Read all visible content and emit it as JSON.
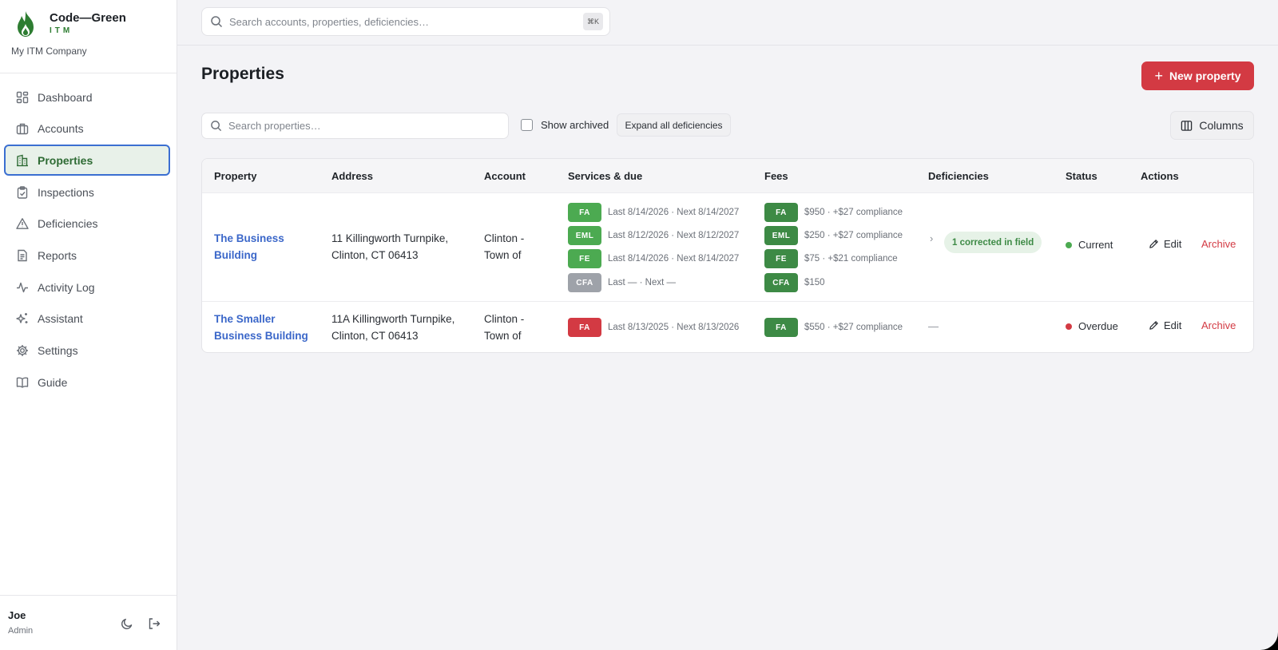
{
  "brand": {
    "name": "Code—Green",
    "sub": "ITM",
    "company": "My ITM Company"
  },
  "nav": [
    {
      "label": "Dashboard",
      "icon": "dashboard-icon"
    },
    {
      "label": "Accounts",
      "icon": "briefcase-icon"
    },
    {
      "label": "Properties",
      "icon": "building-icon",
      "active": true
    },
    {
      "label": "Inspections",
      "icon": "clipboard-check-icon"
    },
    {
      "label": "Deficiencies",
      "icon": "warning-triangle-icon"
    },
    {
      "label": "Reports",
      "icon": "document-icon"
    },
    {
      "label": "Activity Log",
      "icon": "activity-icon"
    },
    {
      "label": "Assistant",
      "icon": "sparkles-icon"
    },
    {
      "label": "Settings",
      "icon": "gear-icon"
    },
    {
      "label": "Guide",
      "icon": "book-icon"
    }
  ],
  "user": {
    "name": "Joe",
    "role": "Admin"
  },
  "search": {
    "placeholder": "Search accounts, properties, deficiencies…",
    "shortcut": "⌘K"
  },
  "page": {
    "title": "Properties",
    "new_button": "New property",
    "search_placeholder": "Search properties…",
    "show_archived": "Show archived",
    "expand_all": "Expand all deficiencies",
    "columns_button": "Columns"
  },
  "table": {
    "headers": [
      "Property",
      "Address",
      "Account",
      "Services & due",
      "Fees",
      "Deficiencies",
      "Status",
      "Actions"
    ],
    "rows": [
      {
        "property": "The Business Building",
        "address_line1": "11 Killingworth Turnpike,",
        "address_line2": "Clinton, CT 06413",
        "account_line1": "Clinton -",
        "account_line2": "Town of",
        "services": [
          {
            "code": "FA",
            "text": "Last 8/14/2026 · Next 8/14/2027",
            "color": "#4caa51"
          },
          {
            "code": "EML",
            "text": "Last 8/12/2026 · Next 8/12/2027",
            "color": "#4caa51"
          },
          {
            "code": "FE",
            "text": "Last 8/14/2026 · Next 8/14/2027",
            "color": "#4caa51"
          },
          {
            "code": "CFA",
            "text": "Last — · Next —",
            "color": "#9ea2a9"
          }
        ],
        "fees": [
          {
            "code": "FA",
            "text": "$950 · +$27 compliance"
          },
          {
            "code": "EML",
            "text": "$250 · +$27 compliance"
          },
          {
            "code": "FE",
            "text": "$75 · +$21 compliance"
          },
          {
            "code": "CFA",
            "text": "$150"
          }
        ],
        "deficiency": "1 corrected in field",
        "status": "Current",
        "status_color": "#4caa51",
        "edit": "Edit",
        "archive": "Archive"
      },
      {
        "property_line1": "The Smaller",
        "property_line2": "Business Building",
        "address_line1": "11A Killingworth Turnpike,",
        "address_line2": "Clinton, CT 06413",
        "account_line1": "Clinton -",
        "account_line2": "Town of",
        "services": [
          {
            "code": "FA",
            "text": "Last 8/13/2025 · Next 8/13/2026",
            "color": "#d33a43"
          }
        ],
        "fees": [
          {
            "code": "FA",
            "text": "$550 · +$27 compliance"
          }
        ],
        "deficiency": "—",
        "status": "Overdue",
        "status_color": "#d33a43",
        "edit": "Edit",
        "archive": "Archive"
      }
    ]
  },
  "colors": {
    "accent_green": "#2e7d32",
    "fee_badge": "#3d8a45",
    "danger": "#d33a43",
    "link": "#3b67c9"
  }
}
